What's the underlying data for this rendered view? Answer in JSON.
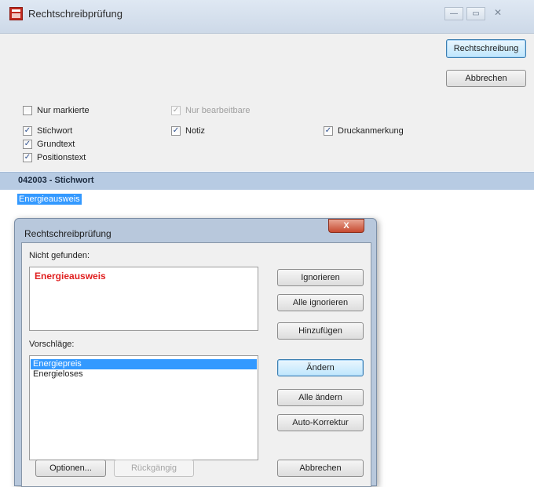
{
  "window": {
    "title": "Rechtschreibprüfung",
    "controls": {
      "minimize": "—",
      "maximize": "▭",
      "close": "✕"
    }
  },
  "toolbar": {
    "check_button": "Rechtschreibung",
    "cancel_button": "Abbrechen"
  },
  "options": {
    "only_marked": {
      "label": "Nur markierte",
      "checked": false
    },
    "only_editable": {
      "label": "Nur bearbeitbare",
      "checked": true,
      "disabled": true
    },
    "keyword": {
      "label": "Stichwort",
      "checked": true
    },
    "note": {
      "label": "Notiz",
      "checked": true
    },
    "print_note": {
      "label": "Druckanmerkung",
      "checked": true
    },
    "base_text": {
      "label": "Grundtext",
      "checked": true
    },
    "position_text": {
      "label": "Positionstext",
      "checked": true
    }
  },
  "section": {
    "header": "042003 - Stichwort",
    "selected_word": "Energieausweis"
  },
  "dialog": {
    "title": "Rechtschreibprüfung",
    "close": "X",
    "not_found_label": "Nicht gefunden:",
    "not_found_word": "Energieausweis",
    "suggestions_label": "Vorschläge:",
    "suggestions": [
      {
        "text": "Energiepreis",
        "selected": true
      },
      {
        "text": "Energieloses",
        "selected": false
      }
    ],
    "buttons": {
      "ignore": "Ignorieren",
      "ignore_all": "Alle ignorieren",
      "add": "Hinzufügen",
      "change": "Ändern",
      "change_all": "Alle ändern",
      "autocorrect": "Auto-Korrektur",
      "options": "Optionen...",
      "undo": "Rückgängig",
      "cancel": "Abbrechen"
    }
  },
  "colors": {
    "not_found_word": "#e02020",
    "selection": "#3399ff",
    "section_header": "#b7cbe3"
  },
  "check_mark": "✓"
}
